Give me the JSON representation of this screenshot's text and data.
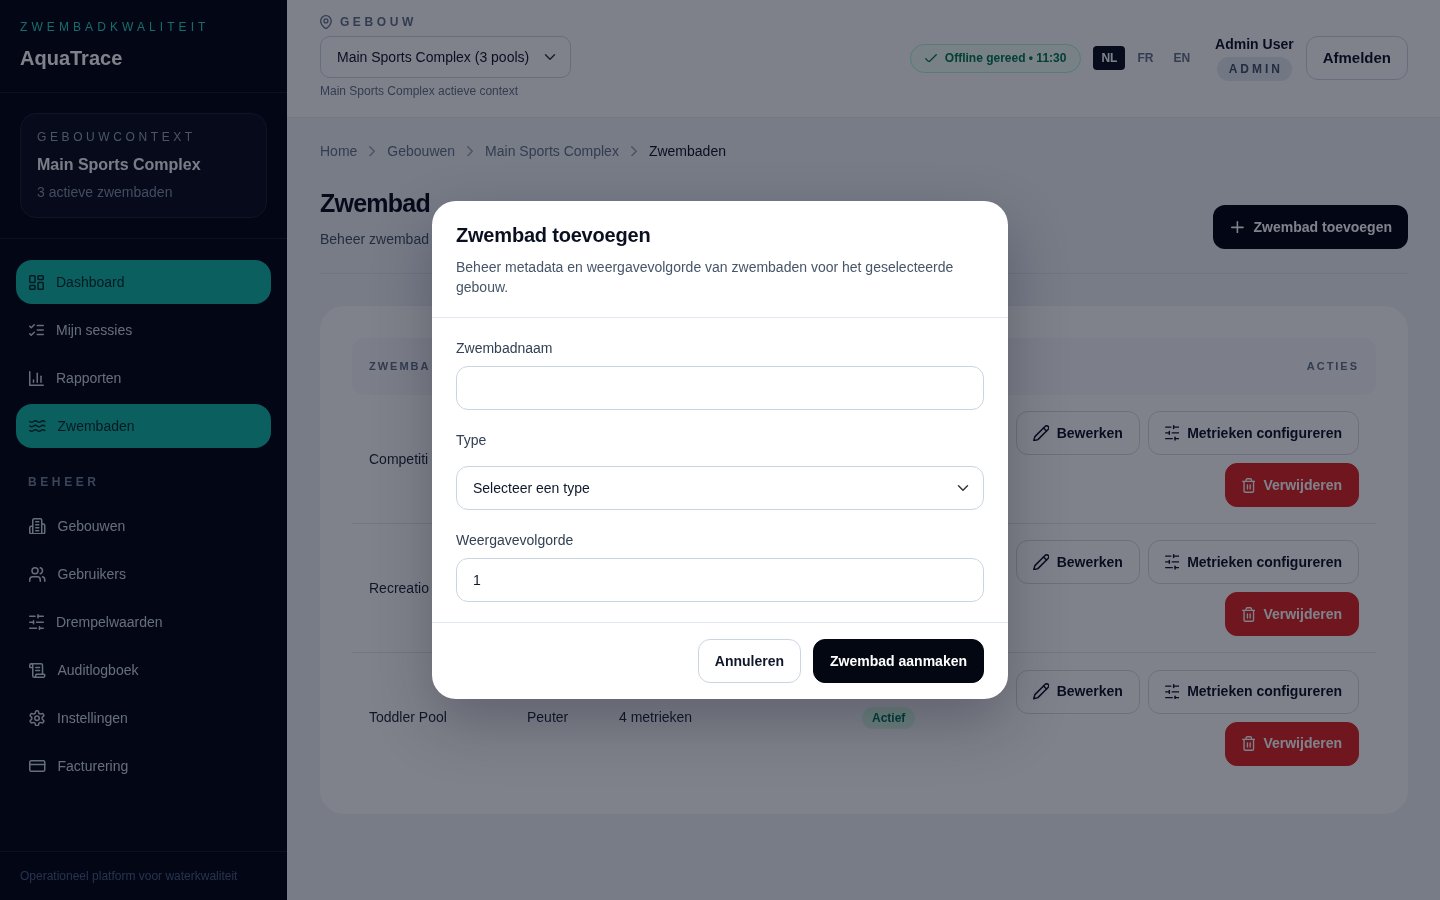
{
  "sidebar": {
    "brand_tagline": "ZWEMBADKWALITEIT",
    "brand_name": "AquaTrace",
    "context_card": {
      "label": "GEBOUWCONTEXT",
      "building": "Main Sports Complex",
      "summary": "3 actieve zwembaden"
    },
    "nav_groups": [
      {
        "items": [
          {
            "label": "Dashboard",
            "selected": true
          },
          {
            "label": "Mijn sessies",
            "selected": false
          },
          {
            "label": "Rapporten",
            "selected": false
          },
          {
            "label": "Zwembaden",
            "selected": true
          }
        ]
      },
      {
        "heading": "BEHEER",
        "items": [
          {
            "label": "Gebouwen",
            "selected": false
          },
          {
            "label": "Gebruikers",
            "selected": false
          },
          {
            "label": "Drempelwaarden",
            "selected": false
          },
          {
            "label": "Auditlogboek",
            "selected": false
          },
          {
            "label": "Instellingen",
            "selected": false
          },
          {
            "label": "Facturering",
            "selected": false
          }
        ]
      }
    ],
    "footer": "Operationeel platform voor waterkwaliteit"
  },
  "header": {
    "building_label": "GEBOUW",
    "building_select": "Main Sports Complex (3 pools)",
    "building_hint": "Main Sports Complex actieve context",
    "sync_status": "Offline gereed • 11:30",
    "languages": [
      {
        "code": "NL",
        "selected": true
      },
      {
        "code": "FR",
        "selected": false
      },
      {
        "code": "EN",
        "selected": false
      }
    ],
    "user": {
      "name": "Admin User",
      "role": "ADMIN"
    },
    "logout": "Afmelden"
  },
  "breadcrumbs": [
    {
      "label": "Home",
      "current": false
    },
    {
      "label": "Gebouwen",
      "current": false
    },
    {
      "label": "Main Sports Complex",
      "current": false
    },
    {
      "label": "Zwembaden",
      "current": true
    }
  ],
  "page": {
    "title": "Zwembad",
    "subtitle": "Beheer zwembad",
    "add_button": "Zwembad toevoegen"
  },
  "table": {
    "columns": [
      "ZWEMBA",
      "ACTIES"
    ],
    "rows": [
      {
        "name": "Competiti",
        "actions": [
          {
            "kind": "edit",
            "label": "Bewerken"
          },
          {
            "kind": "configure",
            "label": "Metrieken configureren"
          },
          {
            "kind": "delete",
            "label": "Verwijderen"
          }
        ]
      },
      {
        "name": "Recreatio",
        "actions": [
          {
            "kind": "edit",
            "label": "Bewerken"
          },
          {
            "kind": "configure",
            "label": "Metrieken configureren"
          },
          {
            "kind": "delete",
            "label": "Verwijderen"
          }
        ]
      },
      {
        "name": "Toddler Pool",
        "type": "Peuter",
        "metrics": "4 metrieken",
        "status": "Actief",
        "actions": [
          {
            "kind": "edit",
            "label": "Bewerken"
          },
          {
            "kind": "configure",
            "label": "Metrieken configureren"
          },
          {
            "kind": "delete",
            "label": "Verwijderen"
          }
        ]
      }
    ]
  },
  "modal": {
    "title": "Zwembad toevoegen",
    "description": "Beheer metadata en weergavevolgorde van zwembaden voor het geselecteerde gebouw.",
    "fields": [
      {
        "kind": "text",
        "label": "Zwembadnaam"
      },
      {
        "kind": "select",
        "label": "Type",
        "value": "Selecteer een type"
      },
      {
        "kind": "number",
        "label": "Weergavevolgorde",
        "value": "1"
      }
    ],
    "buttons": [
      {
        "kind": "secondary",
        "label": "Annuleren"
      },
      {
        "kind": "primary",
        "label": "Zwembad aanmaken"
      }
    ]
  }
}
